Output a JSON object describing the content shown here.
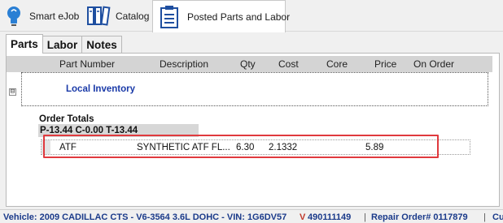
{
  "tabs": [
    {
      "label": "Smart eJob",
      "icon": "lightbulb-icon"
    },
    {
      "label": "Catalog",
      "icon": "catalog-books-icon"
    },
    {
      "label": "Posted Parts and Labor",
      "icon": "clipboard-list-icon",
      "active": true
    }
  ],
  "subtabs": [
    "Parts",
    "Labor",
    "Notes"
  ],
  "columns": [
    "Part Number",
    "Description",
    "Qty",
    "Cost",
    "Core",
    "Price",
    "On Order"
  ],
  "group": {
    "expander": "⊟",
    "label": "Local Inventory"
  },
  "totals": {
    "title": "Order Totals",
    "line": "P-13.44 C-0.00 T-13.44"
  },
  "row": {
    "part_number": "ATF",
    "description": "SYNTHETIC ATF FL...",
    "qty": "6.30",
    "cost": "2.1332",
    "core": "",
    "price": "5.89",
    "on_order": ""
  },
  "status": {
    "vehicle_prefix": "Vehicle: 2009 CADILLAC CTS - V6-3564 3.6L DOHC - VIN: 1G6DV57",
    "vin_char": "V",
    "vin_suffix": "490111149",
    "separator": "|",
    "repair_order": "Repair Order# 0117879",
    "separator2": "|",
    "trailing": "Cu"
  },
  "colors": {
    "accent_blue": "#1a3aa8",
    "highlight_red": "#e03a3e",
    "vin_red": "#c0392b"
  }
}
